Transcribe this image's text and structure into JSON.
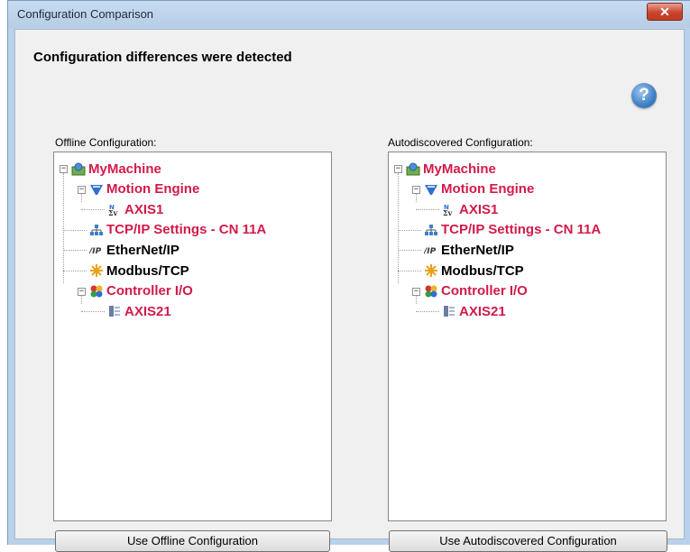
{
  "window": {
    "title": "Configuration Comparison",
    "close_label": "✕"
  },
  "heading": "Configuration differences were detected",
  "help_icon_label": "?",
  "offline": {
    "label": "Offline Configuration:",
    "button": "Use Offline Configuration",
    "tree": [
      {
        "text": "MyMachine",
        "color": "#d21a4a",
        "icon": "machine-icon"
      },
      {
        "text": "Motion Engine",
        "color": "#d21a4a",
        "icon": "motion-engine-icon"
      },
      {
        "text": "AXIS1",
        "color": "#d21a4a",
        "icon": "axis-sigma-icon"
      },
      {
        "text": "TCP/IP Settings - CN 11A",
        "color": "#d21a4a",
        "icon": "network-icon"
      },
      {
        "text": "EtherNet/IP",
        "color": "#000000",
        "icon": "ethernet-ip-icon"
      },
      {
        "text": "Modbus/TCP",
        "color": "#000000",
        "icon": "modbus-icon"
      },
      {
        "text": "Controller I/O",
        "color": "#d21a4a",
        "icon": "controller-io-icon"
      },
      {
        "text": "AXIS21",
        "color": "#d21a4a",
        "icon": "io-device-icon"
      }
    ]
  },
  "autodiscovered": {
    "label": "Autodiscovered Configuration:",
    "button": "Use Autodiscovered Configuration",
    "tree": [
      {
        "text": "MyMachine",
        "color": "#d21a4a",
        "icon": "machine-icon"
      },
      {
        "text": "Motion Engine",
        "color": "#d21a4a",
        "icon": "motion-engine-icon"
      },
      {
        "text": "AXIS1",
        "color": "#d21a4a",
        "icon": "axis-sigma-icon"
      },
      {
        "text": "TCP/IP Settings - CN 11A",
        "color": "#d21a4a",
        "icon": "network-icon"
      },
      {
        "text": "EtherNet/IP",
        "color": "#000000",
        "icon": "ethernet-ip-icon"
      },
      {
        "text": "Modbus/TCP",
        "color": "#000000",
        "icon": "modbus-icon"
      },
      {
        "text": "Controller I/O",
        "color": "#d21a4a",
        "icon": "controller-io-icon"
      },
      {
        "text": "AXIS21",
        "color": "#d21a4a",
        "icon": "io-device-icon"
      }
    ]
  },
  "colors": {
    "changed": "#d21a4a",
    "unchanged": "#000000"
  }
}
